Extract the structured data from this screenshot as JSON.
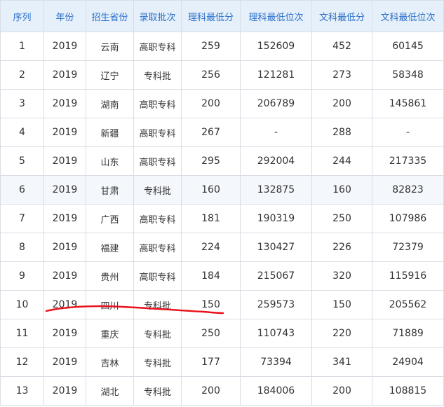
{
  "table": {
    "headers": [
      "序列",
      "年份",
      "招生省份",
      "录取批次",
      "理科最低分",
      "理科最低位次",
      "文科最低分",
      "文科最低位次"
    ],
    "rows": [
      [
        "1",
        "2019",
        "云南",
        "高职专科",
        "259",
        "152609",
        "452",
        "60145"
      ],
      [
        "2",
        "2019",
        "辽宁",
        "专科批",
        "256",
        "121281",
        "273",
        "58348"
      ],
      [
        "3",
        "2019",
        "湖南",
        "高职专科",
        "200",
        "206789",
        "200",
        "145861"
      ],
      [
        "4",
        "2019",
        "新疆",
        "高职专科",
        "267",
        "-",
        "288",
        "-"
      ],
      [
        "5",
        "2019",
        "山东",
        "高职专科",
        "295",
        "292004",
        "244",
        "217335"
      ],
      [
        "6",
        "2019",
        "甘肃",
        "专科批",
        "160",
        "132875",
        "160",
        "82823"
      ],
      [
        "7",
        "2019",
        "广西",
        "高职专科",
        "181",
        "190319",
        "250",
        "107986"
      ],
      [
        "8",
        "2019",
        "福建",
        "高职专科",
        "224",
        "130427",
        "226",
        "72379"
      ],
      [
        "9",
        "2019",
        "贵州",
        "高职专科",
        "184",
        "215067",
        "320",
        "115916"
      ],
      [
        "10",
        "2019",
        "四川",
        "专科批",
        "150",
        "259573",
        "150",
        "205562"
      ],
      [
        "11",
        "2019",
        "重庆",
        "专科批",
        "250",
        "110743",
        "220",
        "71889"
      ],
      [
        "12",
        "2019",
        "吉林",
        "专科批",
        "177",
        "73394",
        "341",
        "24904"
      ],
      [
        "13",
        "2019",
        "湖北",
        "专科批",
        "200",
        "184006",
        "200",
        "108815"
      ]
    ],
    "highlighted_row": 6,
    "underlined_row": 10
  },
  "colors": {
    "header_bg": "#e6f0fb",
    "header_text": "#2a6fc8",
    "border": "#d9dde3",
    "text": "#333333",
    "highlight_row_bg": "#f4f7fc",
    "annotation_stroke": "#e8101a"
  }
}
